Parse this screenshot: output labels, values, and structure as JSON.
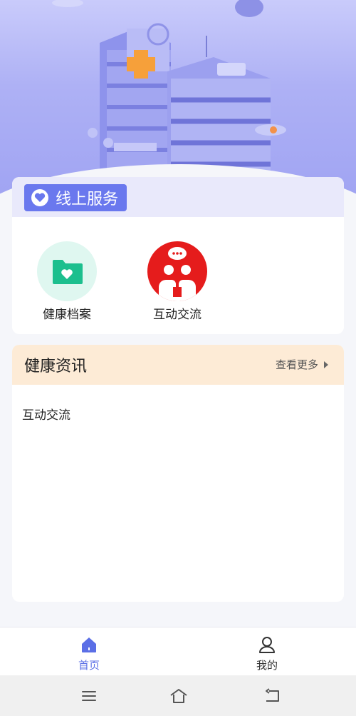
{
  "services": {
    "title": "线上服务",
    "items": [
      {
        "label": "健康档案",
        "icon": "folder-heart-icon"
      },
      {
        "label": "互动交流",
        "icon": "chat-people-icon"
      }
    ]
  },
  "news": {
    "title": "健康资讯",
    "more": "查看更多",
    "items": [
      "互动交流"
    ]
  },
  "tabbar": {
    "home": "首页",
    "mine": "我的"
  },
  "colors": {
    "accent": "#5b6fe6",
    "service_tag": "#6a78ee",
    "news_header": "#fdebd6",
    "record_bg": "#dff7f0",
    "record_icon": "#1cbf8e",
    "chat_bg": "#e51c1c"
  }
}
